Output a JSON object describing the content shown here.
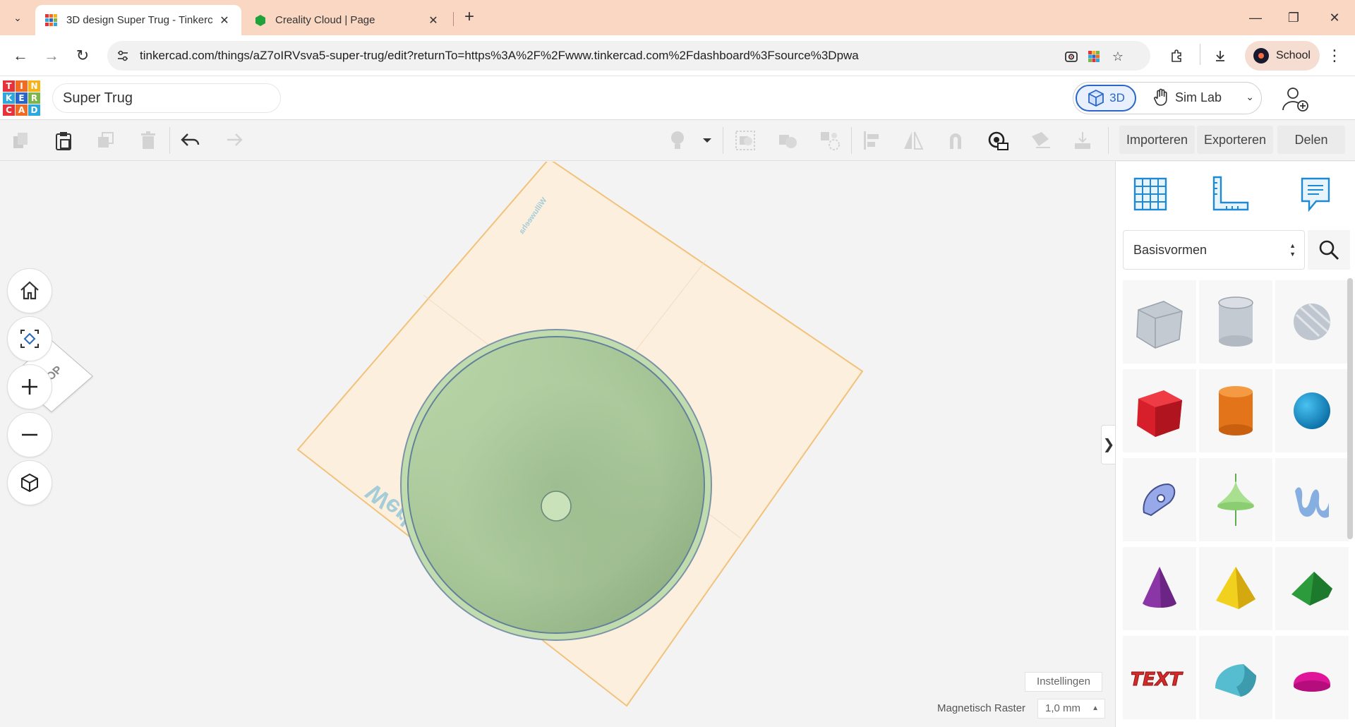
{
  "browser": {
    "tabs": [
      {
        "title": "3D design Super Trug - Tinkercad",
        "active": true
      },
      {
        "title": "Creality Cloud | Page",
        "active": false
      }
    ],
    "url": "tinkercad.com/things/aZ7oIRVsva5-super-trug/edit?returnTo=https%3A%2F%2Fwww.tinkercad.com%2Fdashboard%3Fsource%3Dpwa",
    "profile_label": "School"
  },
  "app": {
    "logo_letters": [
      "T",
      "I",
      "N",
      "K",
      "E",
      "R",
      "C",
      "A",
      "D"
    ],
    "logo_colors": [
      "#e8323a",
      "#f26b22",
      "#f6b21b",
      "#2da8df",
      "#2a66c9",
      "#7ab648",
      "#e8323a",
      "#f26b22",
      "#2da8df"
    ],
    "design_title": "Super Trug",
    "mode_3d_label": "3D",
    "mode_sim_label": "Sim Lab"
  },
  "toolbar": {
    "import_label": "Importeren",
    "export_label": "Exporteren",
    "share_label": "Delen"
  },
  "workspace": {
    "viewcube_label": "TOP",
    "workplane_text_main": "Werkvlakken",
    "workplane_text_small": "Willuweeha",
    "settings_label": "Instellingen",
    "snap_label": "Magnetisch Raster",
    "snap_value": "1,0 mm"
  },
  "panel": {
    "category": "Basisvormen",
    "shapes": [
      {
        "name": "box-striped",
        "color": "#b8bec8"
      },
      {
        "name": "cylinder-striped",
        "color": "#b8bec8"
      },
      {
        "name": "sphere-striped",
        "color": "#b8bec8"
      },
      {
        "name": "box",
        "color": "#e0242f"
      },
      {
        "name": "cylinder",
        "color": "#e87b1e"
      },
      {
        "name": "sphere",
        "color": "#1a9bd7"
      },
      {
        "name": "scribble",
        "color": "#8a9ce6"
      },
      {
        "name": "paraboloid",
        "color": "#9ed88a"
      },
      {
        "name": "text-squiggle",
        "color": "#7fa7d8"
      },
      {
        "name": "cone",
        "color": "#8b3aa8"
      },
      {
        "name": "pyramid",
        "color": "#f2cf1e"
      },
      {
        "name": "roof",
        "color": "#2e9a3e"
      },
      {
        "name": "text",
        "color": "#d42a2a"
      },
      {
        "name": "half-cylinder",
        "color": "#4fb6c8"
      },
      {
        "name": "half-sphere",
        "color": "#e0169a"
      }
    ],
    "text_shape_label": "TEXT"
  },
  "colors": {
    "accent": "#2a66c9",
    "workplane": "#fcefdd",
    "workplane_border": "#f2c27a",
    "disc_light": "#b9d8a8",
    "disc_dark": "#8fb183",
    "disc_rim": "#5b7a8f"
  }
}
